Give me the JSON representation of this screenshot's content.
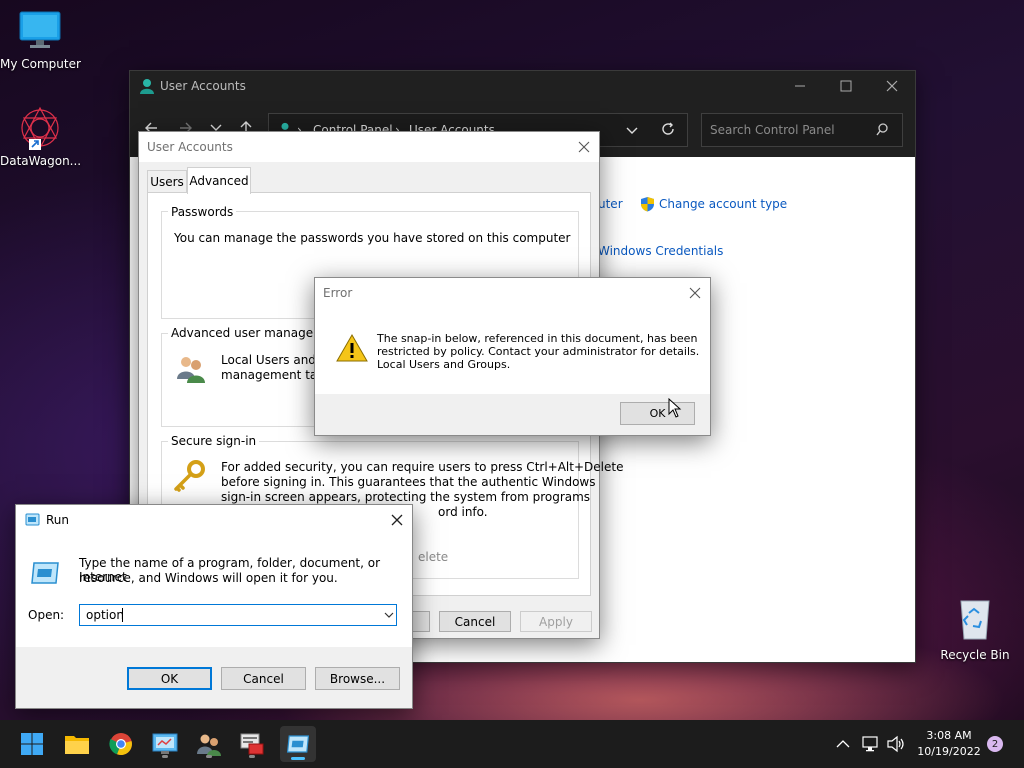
{
  "desktop": {
    "icons": [
      {
        "label": "My Computer"
      },
      {
        "label": "DataWagon..."
      },
      {
        "label": "Recycle Bin"
      }
    ]
  },
  "user_accounts_window": {
    "title": "User Accounts",
    "breadcrumb": [
      "Control Panel",
      "User Accounts"
    ],
    "search_placeholder": "Search Control Panel",
    "link_partial_computer": "uter",
    "link_change_account_type": "Change account type",
    "link_windows_credentials": "Windows Credentials"
  },
  "ua_dialog": {
    "title": "User Accounts",
    "tabs": [
      "Users",
      "Advanced"
    ],
    "active_tab": "Advanced",
    "passwords": {
      "label": "Passwords",
      "text": "You can manage the passwords you have stored on this computer"
    },
    "advanced_user_mgmt": {
      "label": "Advanced user managemen",
      "text_line1": "Local Users and Gr",
      "text_line2": "management task"
    },
    "secure_signin": {
      "label": "Secure sign-in",
      "text_line1": "For added security, you can require users to press Ctrl+Alt+Delete",
      "text_line2": "before signing in. This guarantees that the authentic Windows",
      "text_line3": "sign-in screen appears, protecting the system from programs",
      "text_line4": "ord info.",
      "checkbox_partial": "elete"
    },
    "buttons": {
      "cancel": "Cancel",
      "apply": "Apply"
    }
  },
  "error_dialog": {
    "title": "Error",
    "message_line1": "The snap-in below, referenced in this document, has been",
    "message_line2": "restricted by policy. Contact your administrator for details.",
    "message_line3": "Local Users and Groups.",
    "ok_label": "OK"
  },
  "run_dialog": {
    "title": "Run",
    "description_line1": "Type the name of a program, folder, document, or Internet",
    "description_line2": "resource, and Windows will open it for you.",
    "open_label": "Open:",
    "input_value": "option",
    "buttons": {
      "ok": "OK",
      "cancel": "Cancel",
      "browse": "Browse..."
    }
  },
  "taskbar": {
    "clock_time": "3:08 AM",
    "clock_date": "10/19/2022",
    "notification_count": "2"
  },
  "colors": {
    "accent": "#0078d7",
    "link": "#0a59c0",
    "taskbar": "#1c1c1c"
  }
}
